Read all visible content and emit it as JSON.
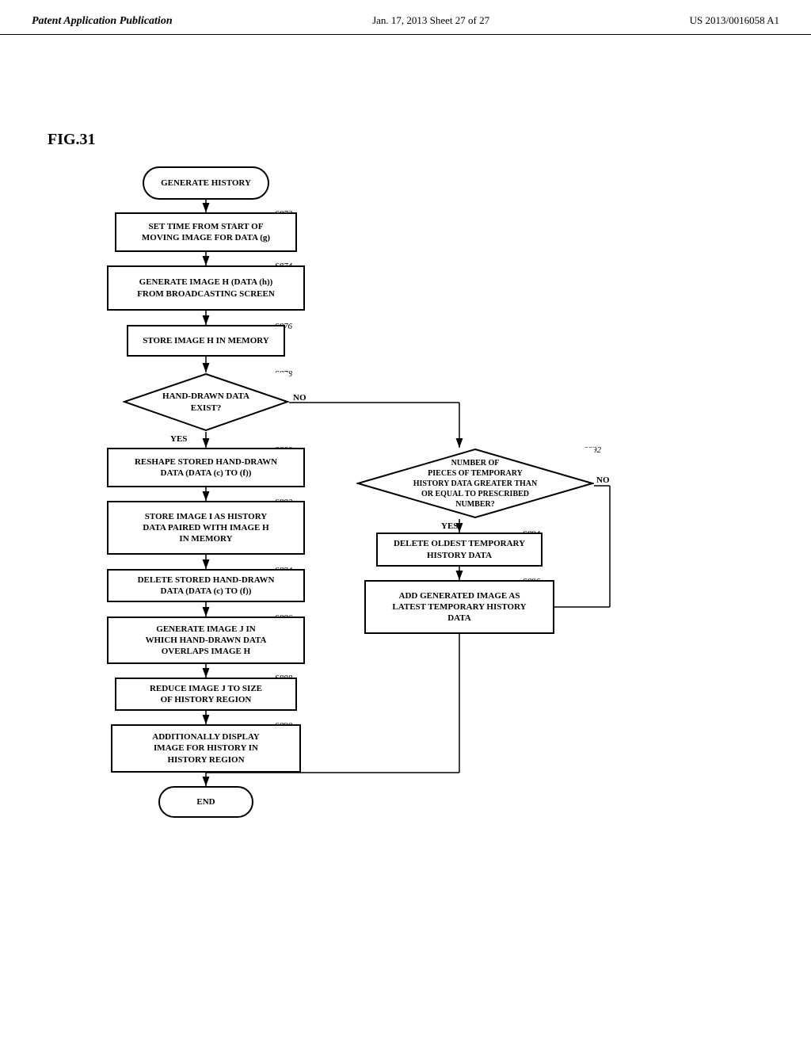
{
  "header": {
    "left": "Patent Application Publication",
    "center": "Jan. 17, 2013   Sheet 27 of 27",
    "right": "US 2013/0016058 A1"
  },
  "fig_label": "FIG.31",
  "nodes": {
    "generate_history": "GENERATE HISTORY",
    "s872_label": "S872",
    "set_time": "SET TIME FROM START OF\nMOVING IMAGE FOR DATA (g)",
    "s874_label": "S874",
    "generate_image_h": "GENERATE IMAGE H (DATA (h))\nFROM BROADCASTING SCREEN",
    "s876_label": "S876",
    "store_image_h": "STORE IMAGE H IN MEMORY",
    "s878_label": "S878",
    "hand_drawn": "HAND-DRAWN DATA\nEXIST?",
    "yes_label": "YES",
    "no_label": "NO",
    "s880_label": "S880",
    "reshape": "RESHAPE STORED HAND-DRAWN\nDATA (DATA (c) TO (f))",
    "s882_label": "S882",
    "store_image_i": "STORE IMAGE I AS HISTORY\nDATA PAIRED WITH IMAGE H\nIN MEMORY",
    "s884_label": "S884",
    "delete_hand_drawn": "DELETE STORED HAND-DRAWN\nDATA (DATA (c) TO (f))",
    "s886_label": "S886",
    "generate_image_j": "GENERATE IMAGE J IN\nWHICH HAND-DRAWN DATA\nOVERLAPS IMAGE H",
    "s888_label": "S888",
    "reduce_image_j": "REDUCE IMAGE J TO SIZE\nOF HISTORY REGION",
    "s890_label": "S890",
    "additionally_display": "ADDITIONALLY DISPLAY\nIMAGE FOR HISTORY IN\nHISTORY REGION",
    "end_label": "END",
    "s892_label": "S892",
    "number_of": "NUMBER OF\nPIECES OF TEMPORARY\nHISTORY DATA GREATER THAN\nOR EQUAL TO PRESCRIBED\nNUMBER?",
    "yes2_label": "YES",
    "no2_label": "NO",
    "s894_label": "S894",
    "delete_oldest": "DELETE OLDEST TEMPORARY\nHISTORY DATA",
    "s896_label": "S896",
    "add_generated": "ADD GENERATED IMAGE AS\nLATEST TEMPORARY HISTORY\nDATA"
  }
}
